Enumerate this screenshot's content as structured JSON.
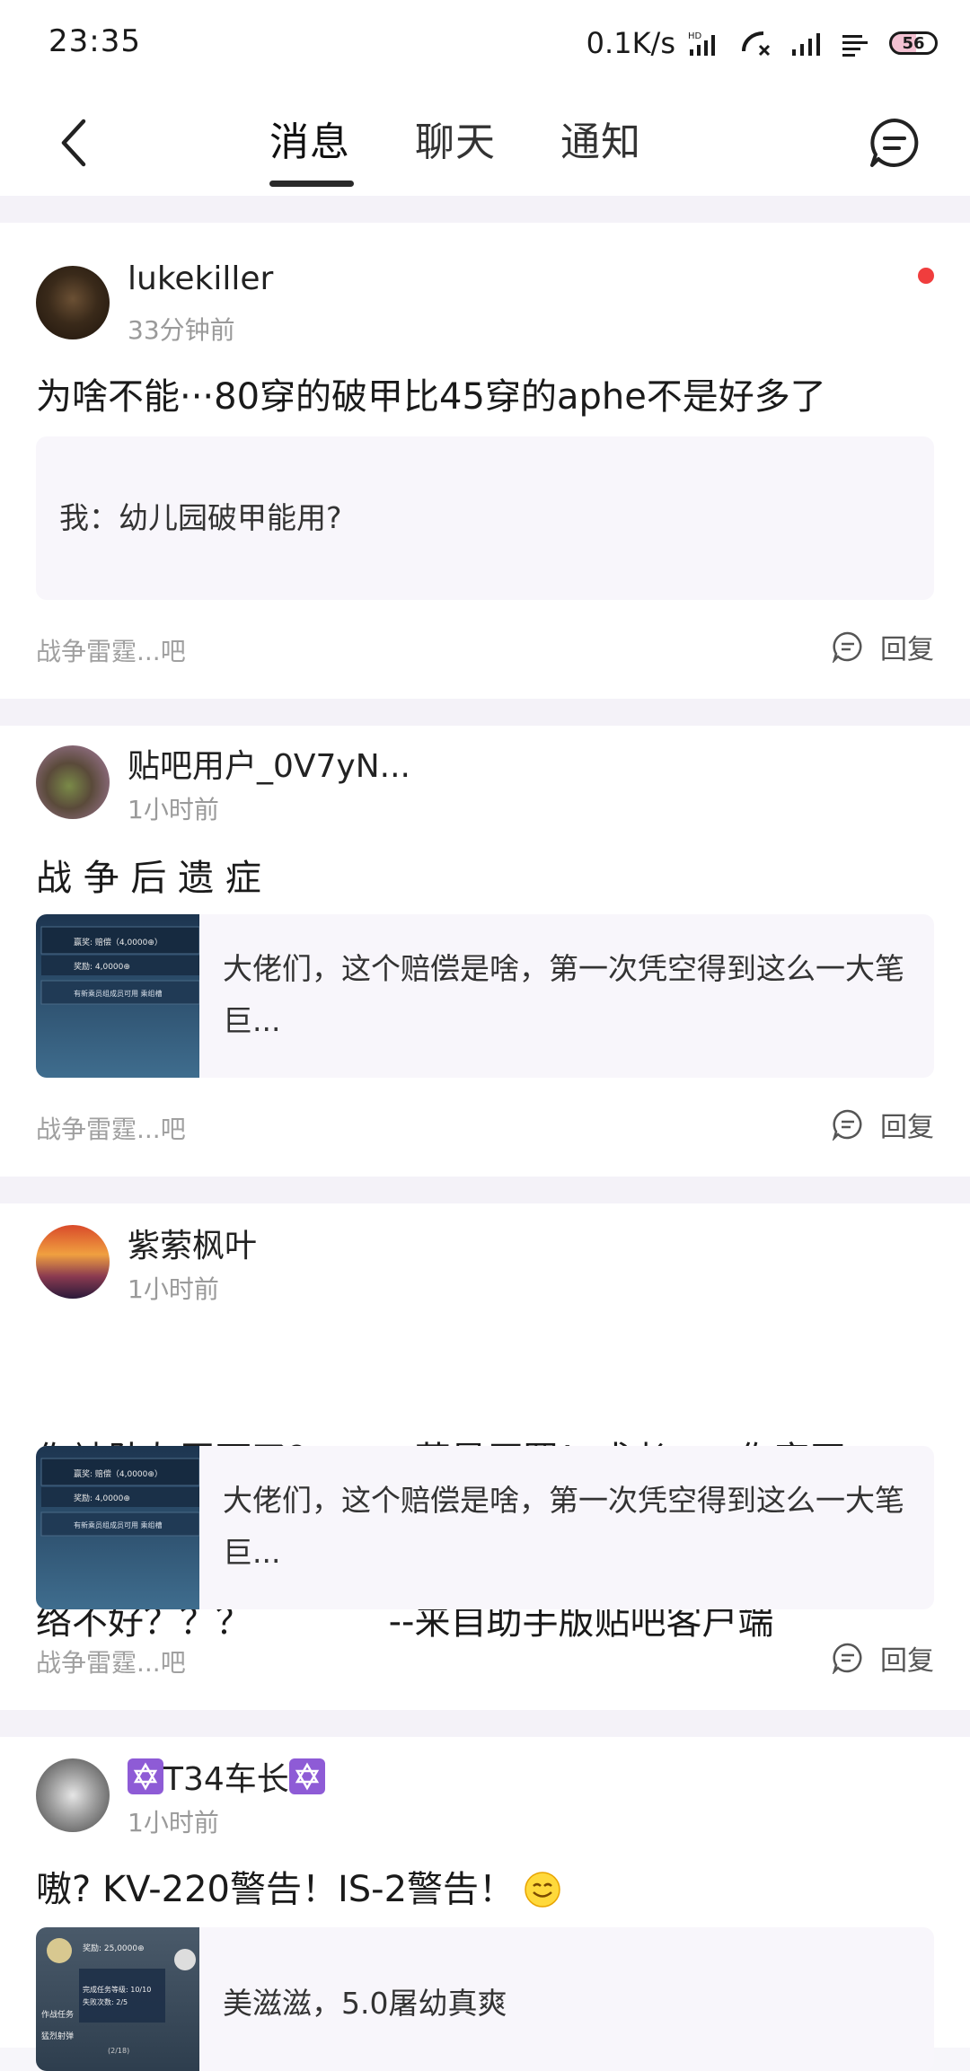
{
  "status_bar": {
    "time": "23:35",
    "net_speed": "0.1K/s",
    "battery": "56"
  },
  "header": {
    "back_icon": "chevron-left-icon",
    "tabs": [
      {
        "label": "消息",
        "active": true
      },
      {
        "label": "聊天",
        "active": false
      },
      {
        "label": "通知",
        "active": false
      }
    ],
    "compose_icon": "message-bubble-icon"
  },
  "messages": [
    {
      "username": "lukekiller",
      "time": "33分钟前",
      "unread": true,
      "content": "为啥不能···80穿的破甲比45穿的aphe不是好多了",
      "quote": "我：幼儿园破甲能用?",
      "forum": "战争雷霆...吧",
      "reply_label": "回复"
    },
    {
      "username": "贴吧用户_0V7yN...",
      "time": "1小时前",
      "content": "战 争 后 遗 症",
      "quote": "大佬们，这个赔偿是啥，第一次凭空得到这么一大笔巨...",
      "thumb_lines": [
        "赢奖: 赔偿（4,0000⊕）",
        "奖励: 4,0000⊕",
        "有新乘员组成员可用 乘组槽"
      ],
      "forum": "战争雷霆...吧",
      "reply_label": "回复"
    },
    {
      "username": "紫萦枫叶",
      "time": "1小时前",
      "content_line1": "你被队友弄死了？        菜是原罪！或者。。。你家网",
      "content_line2": "络不好？？？            --来自助手版贴吧客户端",
      "quote": "大佬们，这个赔偿是啥，第一次凭空得到这么一大笔巨...",
      "thumb_lines": [
        "赢奖: 赔偿（4,0000⊕）",
        "奖励: 4,0000⊕",
        "有新乘员组成员可用 乘组槽"
      ],
      "forum": "战争雷霆...吧",
      "reply_label": "回复"
    },
    {
      "username": "T34车长",
      "time": "1小时前",
      "content": "嗷? KV-220警告！IS-2警告！",
      "quote": "美滋滋，5.0屠幼真爽",
      "thumb_lines": [
        "奖励: 25,0000⊕",
        "完成任务等级: 10/10",
        "失败次数: 2/5",
        "作战任务",
        "猛烈射弹"
      ],
      "thumb_badge": "(2/18)"
    }
  ]
}
